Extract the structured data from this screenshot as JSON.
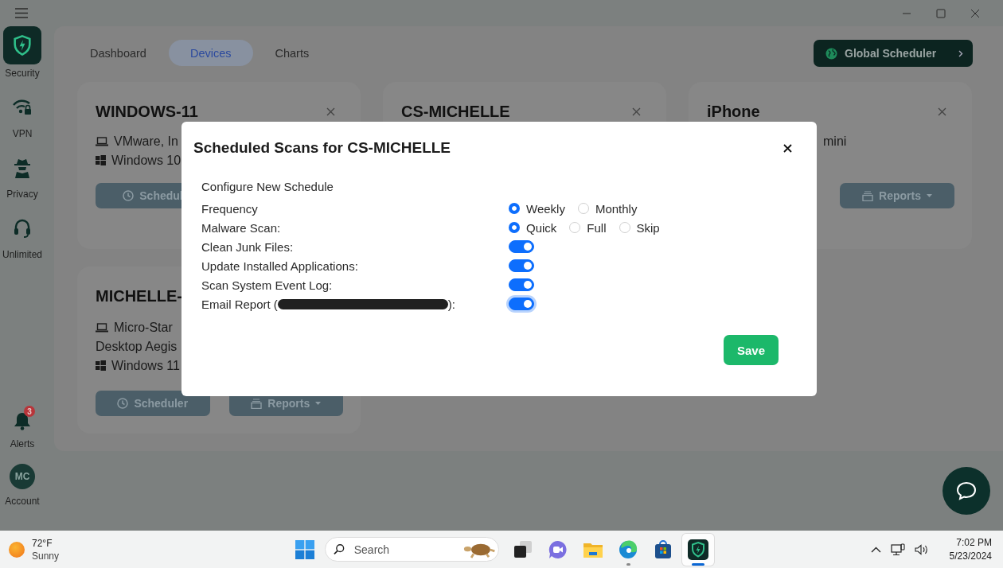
{
  "sidebar": {
    "items": [
      {
        "kind": "shield",
        "label": "Security",
        "selected": true
      },
      {
        "kind": "wifi-lock",
        "label": "VPN",
        "selected": false
      },
      {
        "kind": "spy",
        "label": "Privacy",
        "selected": false
      },
      {
        "kind": "headset",
        "label": "Unlimited",
        "selected": false
      }
    ],
    "alerts": {
      "label": "Alerts",
      "badge": "3"
    },
    "account": {
      "initials": "MC",
      "label": "Account"
    }
  },
  "tabs": [
    {
      "label": "Dashboard",
      "selected": false
    },
    {
      "label": "Devices",
      "selected": true
    },
    {
      "label": "Charts",
      "selected": false
    }
  ],
  "global_scheduler_button": {
    "label": "Global Scheduler"
  },
  "devices": [
    {
      "name": "WINDOWS-11",
      "lines": [
        {
          "kind": "laptop",
          "text": "VMware, In"
        },
        {
          "kind": "windows",
          "text": "Windows 10"
        }
      ],
      "buttons": [
        {
          "kind": "scheduler",
          "label": "Schedul"
        }
      ]
    },
    {
      "name": "CS-MICHELLE"
    },
    {
      "name": "iPhone",
      "lines": [
        {
          "kind": "hidden-start",
          "text": "mini"
        }
      ],
      "buttons": [
        {
          "kind": "reports",
          "label": "Reports"
        }
      ]
    },
    {
      "name": "MICHELLE-",
      "lines": [
        {
          "kind": "laptop",
          "text": "Micro-Star"
        },
        {
          "kind": "plain",
          "text": "Desktop Aegis"
        },
        {
          "kind": "windows",
          "text": "Windows 11"
        }
      ],
      "buttons": [
        {
          "kind": "scheduler",
          "label": "Scheduler"
        },
        {
          "kind": "reports",
          "label": "Reports"
        }
      ]
    }
  ],
  "dialog": {
    "title": "Scheduled Scans for CS-MICHELLE",
    "section": "Configure New Schedule",
    "rows": [
      {
        "kind": "radio",
        "label": "Frequency",
        "options": [
          {
            "label": "Weekly",
            "selected": true
          },
          {
            "label": "Monthly",
            "selected": false
          }
        ]
      },
      {
        "kind": "radio",
        "label": "Malware Scan:",
        "options": [
          {
            "label": "Quick",
            "selected": true
          },
          {
            "label": "Full",
            "selected": false
          },
          {
            "label": "Skip",
            "selected": false
          }
        ]
      },
      {
        "kind": "toggle",
        "label": "Clean Junk Files:",
        "on": true,
        "focused": false
      },
      {
        "kind": "toggle",
        "label": "Update Installed Applications:",
        "on": true,
        "focused": false
      },
      {
        "kind": "toggle",
        "label": "Scan System Event Log:",
        "on": true,
        "focused": false
      },
      {
        "kind": "toggle",
        "label": "Email Report (",
        "redacted": true,
        "label_suffix": "):",
        "on": true,
        "focused": true
      }
    ],
    "save_button": "Save"
  },
  "taskbar": {
    "weather": {
      "temp": "72°F",
      "condition": "Sunny"
    },
    "search": {
      "placeholder": "Search"
    },
    "apps": [
      {
        "kind": "task-view",
        "running": false,
        "active": false
      },
      {
        "kind": "chat",
        "running": false,
        "active": false
      },
      {
        "kind": "folder",
        "running": false,
        "active": false
      },
      {
        "kind": "edge",
        "running": true,
        "active": false
      },
      {
        "kind": "store",
        "running": false,
        "active": false
      },
      {
        "kind": "shield",
        "running": true,
        "active": true
      }
    ],
    "clock": {
      "time": "7:02 PM",
      "date": "5/23/2024"
    }
  }
}
